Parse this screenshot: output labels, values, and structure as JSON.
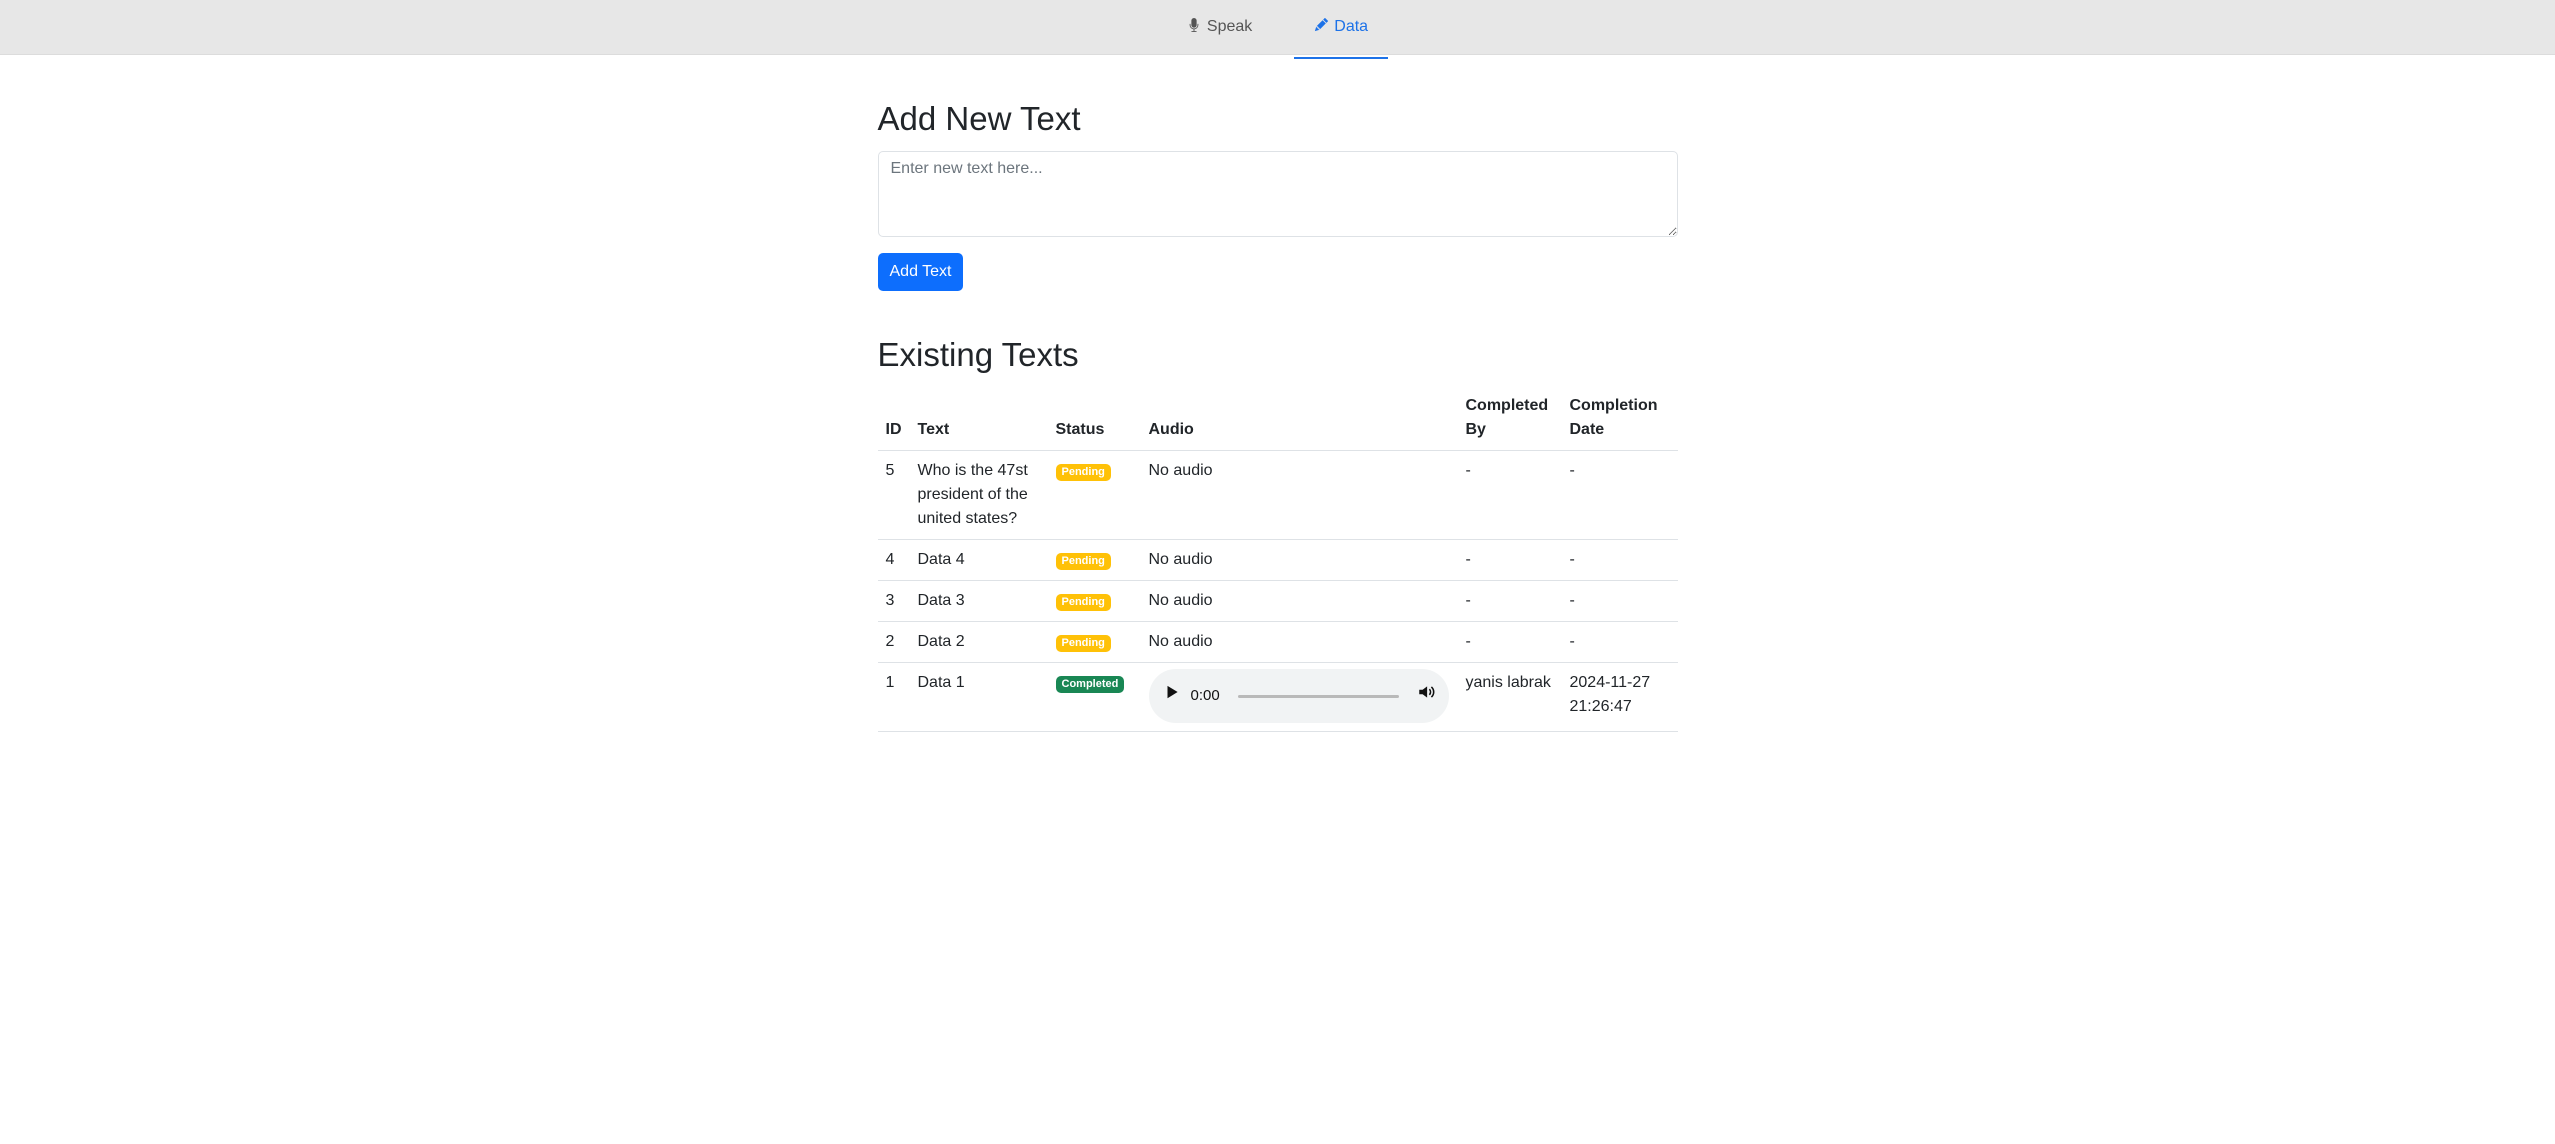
{
  "nav": {
    "tabs": [
      {
        "label": "Speak",
        "icon": "microphone-icon"
      },
      {
        "label": "Data",
        "icon": "pencil-icon"
      }
    ],
    "active": "Data",
    "accent_color": "#1d72e8"
  },
  "add_section": {
    "title": "Add New Text",
    "placeholder": "Enter new text here...",
    "button_label": "Add Text",
    "button_color": "#0d6efd"
  },
  "existing_section": {
    "title": "Existing Texts",
    "columns": [
      "ID",
      "Text",
      "Status",
      "Audio",
      "Completed By",
      "Completion Date"
    ],
    "rows": [
      {
        "id": "5",
        "text": "Who is the 47st president of the united states?",
        "status": "Pending",
        "audio": "No audio",
        "completed_by": "-",
        "completion_date": "-"
      },
      {
        "id": "4",
        "text": "Data 4",
        "status": "Pending",
        "audio": "No audio",
        "completed_by": "-",
        "completion_date": "-"
      },
      {
        "id": "3",
        "text": "Data 3",
        "status": "Pending",
        "audio": "No audio",
        "completed_by": "-",
        "completion_date": "-"
      },
      {
        "id": "2",
        "text": "Data 2",
        "status": "Pending",
        "audio": "No audio",
        "completed_by": "-",
        "completion_date": "-"
      },
      {
        "id": "1",
        "text": "Data 1",
        "status": "Completed",
        "audio": null,
        "audio_time": "0:00",
        "completed_by": "yanis labrak",
        "completion_date": "2024-11-27 21:26:47"
      }
    ],
    "status_colors": {
      "Pending": "#ffc107",
      "Completed": "#198754"
    }
  }
}
